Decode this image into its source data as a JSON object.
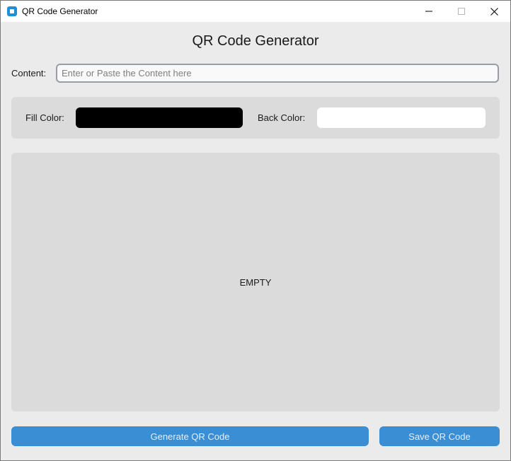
{
  "window": {
    "title": "QR Code Generator"
  },
  "main": {
    "heading": "QR Code Generator",
    "content_label": "Content:",
    "content_value": "",
    "content_placeholder": "Enter or Paste the Content here",
    "fill_color_label": "Fill Color:",
    "fill_color_value": "#000000",
    "back_color_label": "Back Color:",
    "back_color_value": "#ffffff",
    "qr_preview_text": "EMPTY",
    "generate_button": "Generate QR Code",
    "save_button": "Save QR Code"
  },
  "icons": {
    "app": "qr-app-icon",
    "minimize": "minimize-icon",
    "maximize": "maximize-icon",
    "close": "close-icon"
  },
  "colors": {
    "accent": "#3a8ed4",
    "frame": "#dbdbdb",
    "background": "#ebebeb"
  }
}
